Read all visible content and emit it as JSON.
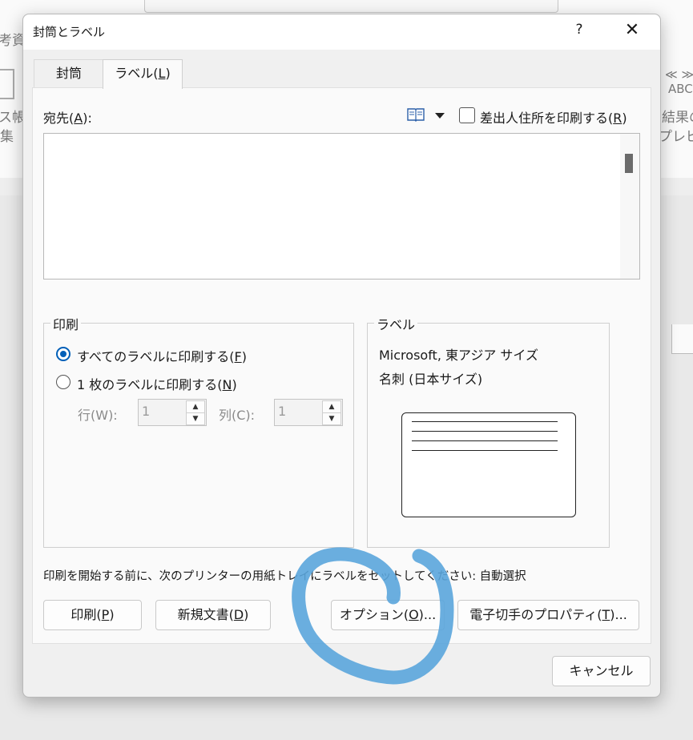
{
  "background": {
    "left_partial_1": "考資",
    "left_partial_2": "ス帳",
    "left_partial_3": "集",
    "right_partial_1": "≪ ≫",
    "right_partial_2": "ABC",
    "right_partial_3": "結果の",
    "right_partial_4": "プレビュ"
  },
  "dialog": {
    "title": "封筒とラベル",
    "help": "?",
    "close": "✕"
  },
  "tabs": [
    {
      "label": "封筒"
    },
    {
      "label_pre": "ラベル(",
      "key": "L",
      "label_post": ")"
    }
  ],
  "address": {
    "label_pre": "宛先(",
    "key": "A",
    "label_post": "):",
    "value": "",
    "return_address_pre": "差出人住所を印刷する(",
    "return_address_key": "R",
    "return_address_post": ")",
    "return_address_checked": false
  },
  "print_group": {
    "title": "印刷",
    "option_all_pre": "すべてのラベルに印刷する(",
    "option_all_key": "F",
    "option_all_post": ")",
    "option_single_pre": "1 枚のラベルに印刷する(",
    "option_single_key": "N",
    "option_single_post": ")",
    "selected": "all",
    "row_label": "行(W):",
    "row_value": "1",
    "col_label": "列(C):",
    "col_value": "1"
  },
  "label_group": {
    "title": "ラベル",
    "line1": "Microsoft, 東アジア サイズ",
    "line2": "名刺 (日本サイズ)"
  },
  "instruction": "印刷を開始する前に、次のプリンターの用紙トレイにラベルをセットしてください: 自動選択",
  "buttons": {
    "print_pre": "印刷(",
    "print_key": "P",
    "print_post": ")",
    "new_doc_pre": "新規文書(",
    "new_doc_key": "D",
    "new_doc_post": ")",
    "options_pre": "オプション(",
    "options_key": "O",
    "options_post": ")...",
    "postage_pre": "電子切手のプロパティ(",
    "postage_key": "T",
    "postage_post": ")...",
    "cancel": "キャンセル"
  },
  "colors": {
    "accent": "#005fb8",
    "annotation": "#5aa5dc"
  }
}
